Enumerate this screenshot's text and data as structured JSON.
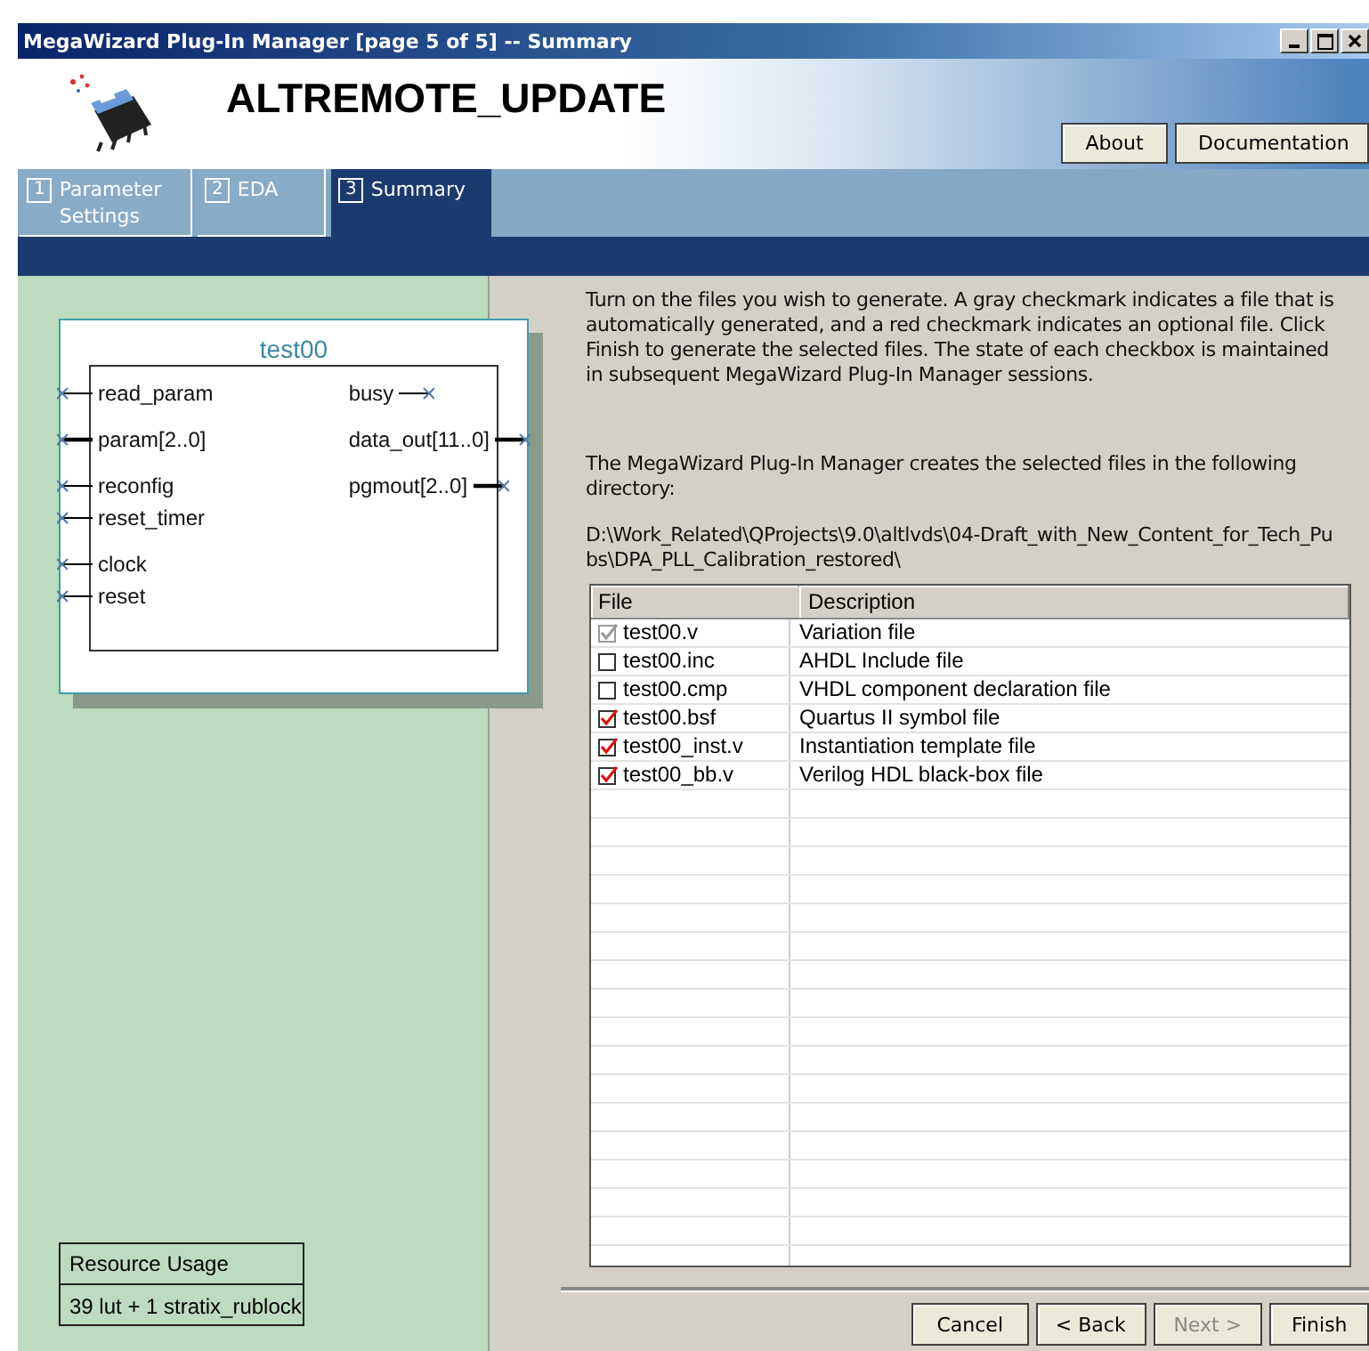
{
  "window": {
    "title": "MegaWizard Plug-In Manager [page 5 of 5] -- Summary"
  },
  "header": {
    "title": "ALTREMOTE_UPDATE",
    "buttons": [
      "About",
      "Documentation"
    ]
  },
  "tabs": [
    {
      "number": "1",
      "label": "Parameter Settings",
      "selected": false
    },
    {
      "number": "2",
      "label": "EDA",
      "selected": false
    },
    {
      "number": "3",
      "label": "Summary",
      "selected": true
    }
  ],
  "symbol": {
    "name": "test00",
    "input_groups": [
      {
        "ports": [
          {
            "name": "read_param",
            "bus": false
          }
        ]
      },
      {
        "ports": [
          {
            "name": "param[2..0]",
            "bus": true
          }
        ]
      },
      {
        "ports": [
          {
            "name": "reconfig",
            "bus": false
          },
          {
            "name": "reset_timer",
            "bus": false
          }
        ]
      },
      {
        "ports": [
          {
            "name": "clock",
            "bus": false
          },
          {
            "name": "reset",
            "bus": false
          }
        ]
      }
    ],
    "output_groups": [
      {
        "ports": [
          {
            "name": "busy",
            "bus": false
          }
        ]
      },
      {
        "ports": [
          {
            "name": "data_out[11..0]",
            "bus": true
          }
        ]
      },
      {
        "ports": [
          {
            "name": "pgmout[2..0]",
            "bus": true
          }
        ]
      }
    ]
  },
  "resource_usage": {
    "heading": "Resource Usage",
    "value": "39 lut + 1 stratix_rublock"
  },
  "instructions": "Turn on the files you wish to generate. A gray checkmark indicates a file that is automatically generated, and a red checkmark indicates an optional file. Click Finish to generate the selected files. The state of each checkbox is maintained in subsequent MegaWizard Plug-In Manager sessions.",
  "directory_note": "The MegaWizard Plug-In Manager creates the selected files in the following directory:",
  "directory": "D:\\Work_Related\\QProjects\\9.0\\altlvds\\04-Draft_with_New_Content_for_Tech_Pubs\\DPA_PLL_Calibration_restored\\",
  "table": {
    "columns": [
      "File",
      "Description"
    ],
    "rows": [
      {
        "file": "test00.v",
        "description": "Variation file",
        "checked": true,
        "kind": "auto"
      },
      {
        "file": "test00.inc",
        "description": "AHDL Include file",
        "checked": false,
        "kind": "optional"
      },
      {
        "file": "test00.cmp",
        "description": "VHDL component declaration file",
        "checked": false,
        "kind": "optional"
      },
      {
        "file": "test00.bsf",
        "description": "Quartus II symbol file",
        "checked": true,
        "kind": "optional"
      },
      {
        "file": "test00_inst.v",
        "description": "Instantiation template file",
        "checked": true,
        "kind": "optional"
      },
      {
        "file": "test00_bb.v",
        "description": "Verilog HDL black-box file",
        "checked": true,
        "kind": "optional"
      }
    ]
  },
  "buttons": [
    {
      "label": "Cancel",
      "disabled": false
    },
    {
      "label": "< Back",
      "disabled": false
    },
    {
      "label": "Next >",
      "disabled": true
    },
    {
      "label": "Finish",
      "disabled": false
    }
  ]
}
